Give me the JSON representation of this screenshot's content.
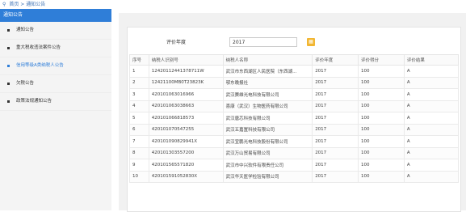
{
  "breadcrumb": {
    "home": "首页",
    "sep": ">",
    "current": "通知公告"
  },
  "sidebar": {
    "header": "通知公告",
    "items": [
      {
        "label": "通知公告"
      },
      {
        "label": "重大税收违法案件公告"
      },
      {
        "label": "信用等级A类纳税人公告"
      },
      {
        "label": "欠税公告"
      },
      {
        "label": "政策法规通知公告"
      }
    ]
  },
  "filter": {
    "label": "评价年度",
    "value": "2017"
  },
  "table": {
    "headers": [
      "序号",
      "纳税人识别号",
      "纳税人名称",
      "评价年度",
      "评价得分",
      "评价结果"
    ],
    "rows": [
      [
        "1",
        "124201124413787​11W",
        "武汉市东西湖区人民医院（东西湖...",
        "2017",
        "100",
        "A"
      ],
      [
        "2",
        "12421100MB0T23823K",
        "鄂东晚报社",
        "2017",
        "100",
        "A"
      ],
      [
        "3",
        "420101063016966",
        "武汉赛维光电科技有限公司",
        "2017",
        "100",
        "A"
      ],
      [
        "4",
        "420101063038663",
        "喜康（武汉）生物医药有限公司",
        "2017",
        "100",
        "A"
      ],
      [
        "5",
        "420101066818573",
        "武汉唐芯科技有限公司",
        "2017",
        "100",
        "A"
      ],
      [
        "6",
        "420101070547255",
        "武汉五嘉置科技有限公司",
        "2017",
        "100",
        "A"
      ],
      [
        "7",
        "420101090829941X",
        "武汉宜鹏光电科技股份有限公司",
        "2017",
        "100",
        "A"
      ],
      [
        "8",
        "420101303557200",
        "武汉万山贸易有限公司",
        "2017",
        "100",
        "A"
      ],
      [
        "9",
        "420101565571820",
        "武汉市中兴软件有限责任公司",
        "2017",
        "100",
        "A"
      ],
      [
        "10",
        "420101591052830X",
        "武汉华天医学检验有限公司",
        "2017",
        "100",
        "A"
      ]
    ]
  },
  "colors": {
    "accent": "#2f7ed8",
    "calendar": "#f2b632"
  }
}
